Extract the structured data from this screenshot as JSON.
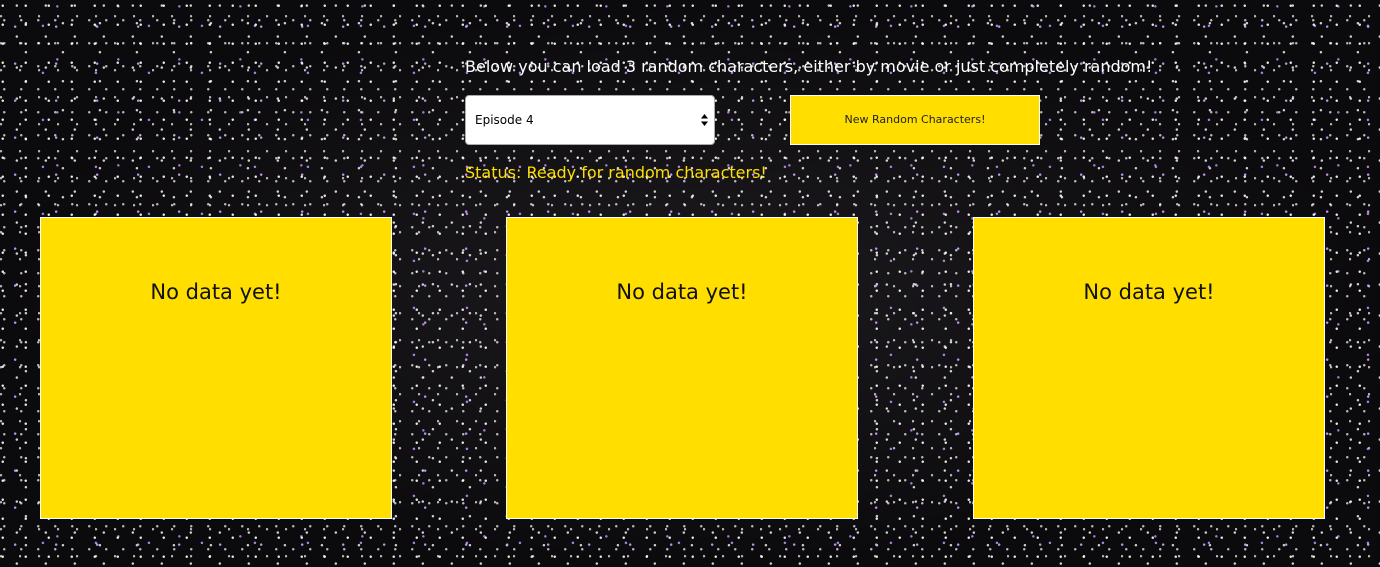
{
  "intro": {
    "text": "Below you can load 3 random characters, either by movie or just completely random!"
  },
  "controls": {
    "episode_select": {
      "selected": "Episode 4"
    },
    "random_button_label": "New Random Characters!"
  },
  "status": {
    "text": "Status: Ready for random characters!"
  },
  "cards": [
    {
      "text": "No data yet!"
    },
    {
      "text": "No data yet!"
    },
    {
      "text": "No data yet!"
    }
  ],
  "colors": {
    "accent_yellow": "#ffde00",
    "background": "#0b0a0c",
    "text_white": "#ffffff"
  },
  "icons": {
    "select_arrows": "up-down-arrows-icon"
  }
}
